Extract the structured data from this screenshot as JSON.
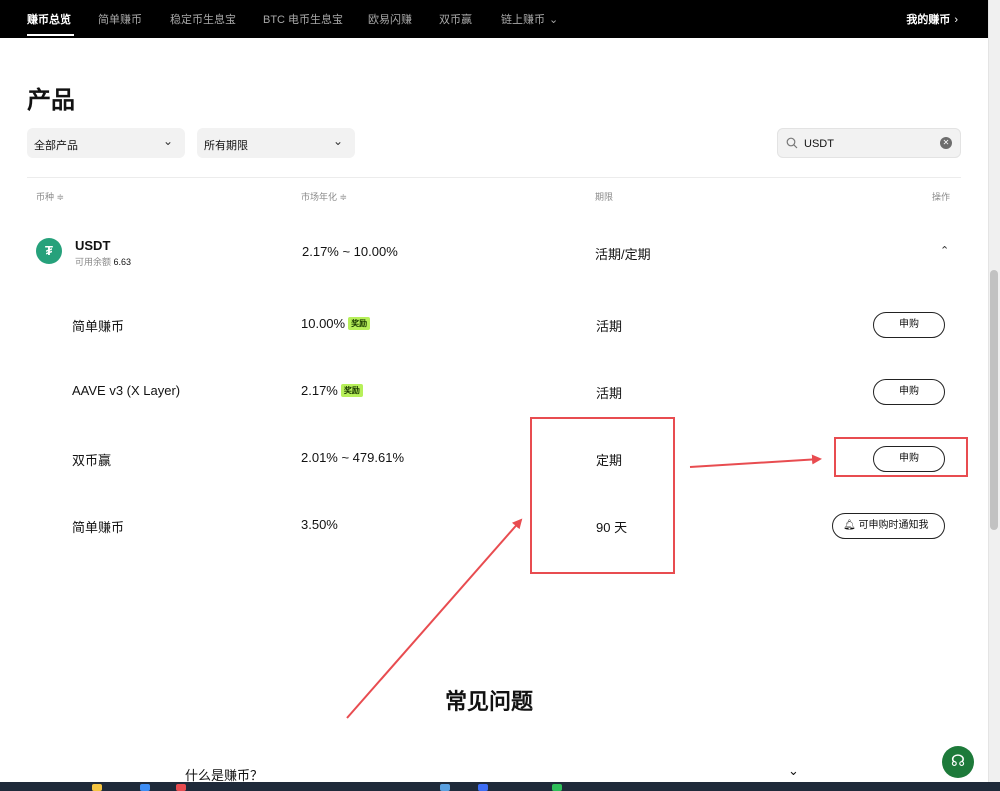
{
  "nav": {
    "items": [
      {
        "label": "赚币总览",
        "active": true
      },
      {
        "label": "简单赚币"
      },
      {
        "label": "稳定币生息宝"
      },
      {
        "label": "BTC 电币生息宝"
      },
      {
        "label": "欧易闪赚"
      },
      {
        "label": "双币赢"
      },
      {
        "label": "链上赚币"
      }
    ],
    "right_label": "我的赚币"
  },
  "page_title": "产品",
  "filters": {
    "product": "全部产品",
    "term": "所有期限"
  },
  "search": {
    "value": "USDT"
  },
  "table": {
    "headers": {
      "coin": "币种 ≑",
      "apr": "市场年化 ≑",
      "term": "期限",
      "action": "操作"
    },
    "coin": {
      "symbol_glyph": "₮",
      "name": "USDT",
      "balance_label": "可用余额",
      "balance_value": "6.63",
      "apr": "2.17% ~ 10.00%",
      "term": "活期/定期"
    },
    "products": [
      {
        "name": "简单赚币",
        "apr": "10.00%",
        "badge": "奖励",
        "term": "活期",
        "action": "申购"
      },
      {
        "name": "AAVE v3 (X Layer)",
        "apr": "2.17%",
        "badge": "奖励",
        "term": "活期",
        "action": "申购"
      },
      {
        "name": "双币赢",
        "apr": "2.01% ~ 479.61%",
        "badge": "",
        "term": "定期",
        "action": "申购"
      },
      {
        "name": "简单赚币",
        "apr": "3.50%",
        "badge": "",
        "term": "90 天",
        "action": "可申购时通知我"
      }
    ]
  },
  "faq": {
    "title": "常见问题",
    "first_question": "什么是赚币？"
  },
  "colors": {
    "annotation_red": "#e84c50",
    "badge_green": "#b7f05a",
    "usdt_green": "#26a17b",
    "support_green": "#1d7a3a"
  },
  "icons": [
    "search-icon",
    "clear-icon",
    "chevron-down-icon",
    "chevron-up-icon",
    "chevron-right-icon",
    "bell-icon",
    "headset-icon",
    "usdt-icon"
  ]
}
